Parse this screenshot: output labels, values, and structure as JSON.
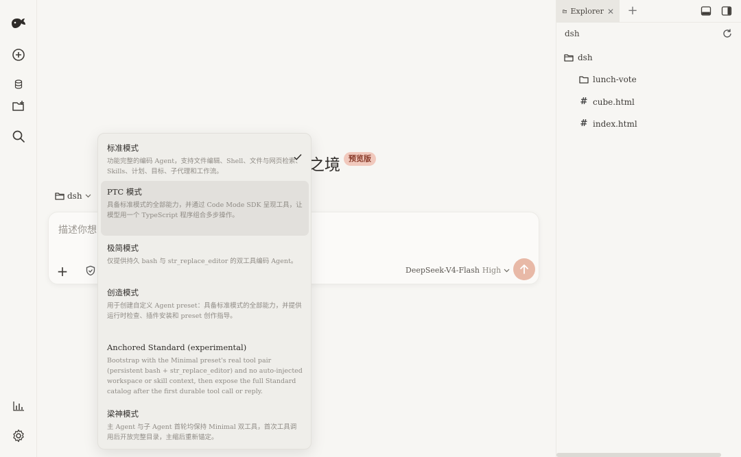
{
  "title_fragment": "之境",
  "badge": "预览版",
  "project": {
    "name": "dsh"
  },
  "composer": {
    "placeholder": "描述你想",
    "model": "DeepSeek-V4-Flash",
    "effort": "High"
  },
  "mode_menu": {
    "selected": 0,
    "options": [
      {
        "name": "标准模式",
        "desc": "功能完整的编码 Agent，支持文件编辑、Shell、文件与网页检索、Skills、计划、目标、子代理和工作流。"
      },
      {
        "name": "PTC 模式",
        "desc": "具备标准模式的全部能力，并通过 Code Mode SDK 呈现工具，让模型用一个 TypeScript 程序组合多步操作。"
      },
      {
        "name": "极简模式",
        "desc": "仅提供持久 bash 与 str_replace_editor 的双工具编码 Agent。"
      },
      {
        "name": "创造模式",
        "desc": "用于创建自定义 Agent preset：具备标准模式的全部能力，并提供运行时检查、插件安装和 preset 创作指导。"
      },
      {
        "name": "Anchored Standard (experimental)",
        "desc": "Bootstrap with the Minimal preset's real tool pair (persistent bash + str_replace_editor) and no auto-injected workspace or skill context, then expose the full Standard catalog after the first durable tool call or reply."
      },
      {
        "name": "梁神模式",
        "desc": "主 Agent 与子 Agent 首轮均保持 Minimal 双工具，首次工具调用后开放完整目录，主缩后重新锚定。"
      }
    ]
  },
  "explorer": {
    "tab_label": "Explorer",
    "root_label": "dsh",
    "tree": [
      {
        "label": "dsh",
        "type": "folder",
        "depth": 0
      },
      {
        "label": "lunch-vote",
        "type": "folder",
        "depth": 1
      },
      {
        "label": "cube.html",
        "type": "file",
        "depth": 1
      },
      {
        "label": "index.html",
        "type": "file",
        "depth": 1
      }
    ]
  },
  "icons": {
    "logo": "whale-logo-icon",
    "new_chat": "plus-circle-icon",
    "database": "database-icon",
    "new_folder": "folder-plus-icon",
    "search": "search-icon",
    "stats": "bar-chart-icon",
    "settings": "gear-icon"
  },
  "colors": {
    "accent": "#e8b9a7",
    "badge_bg": "#f1c9bd",
    "badge_text": "#8a3c2b",
    "background": "#f7f6f3"
  }
}
